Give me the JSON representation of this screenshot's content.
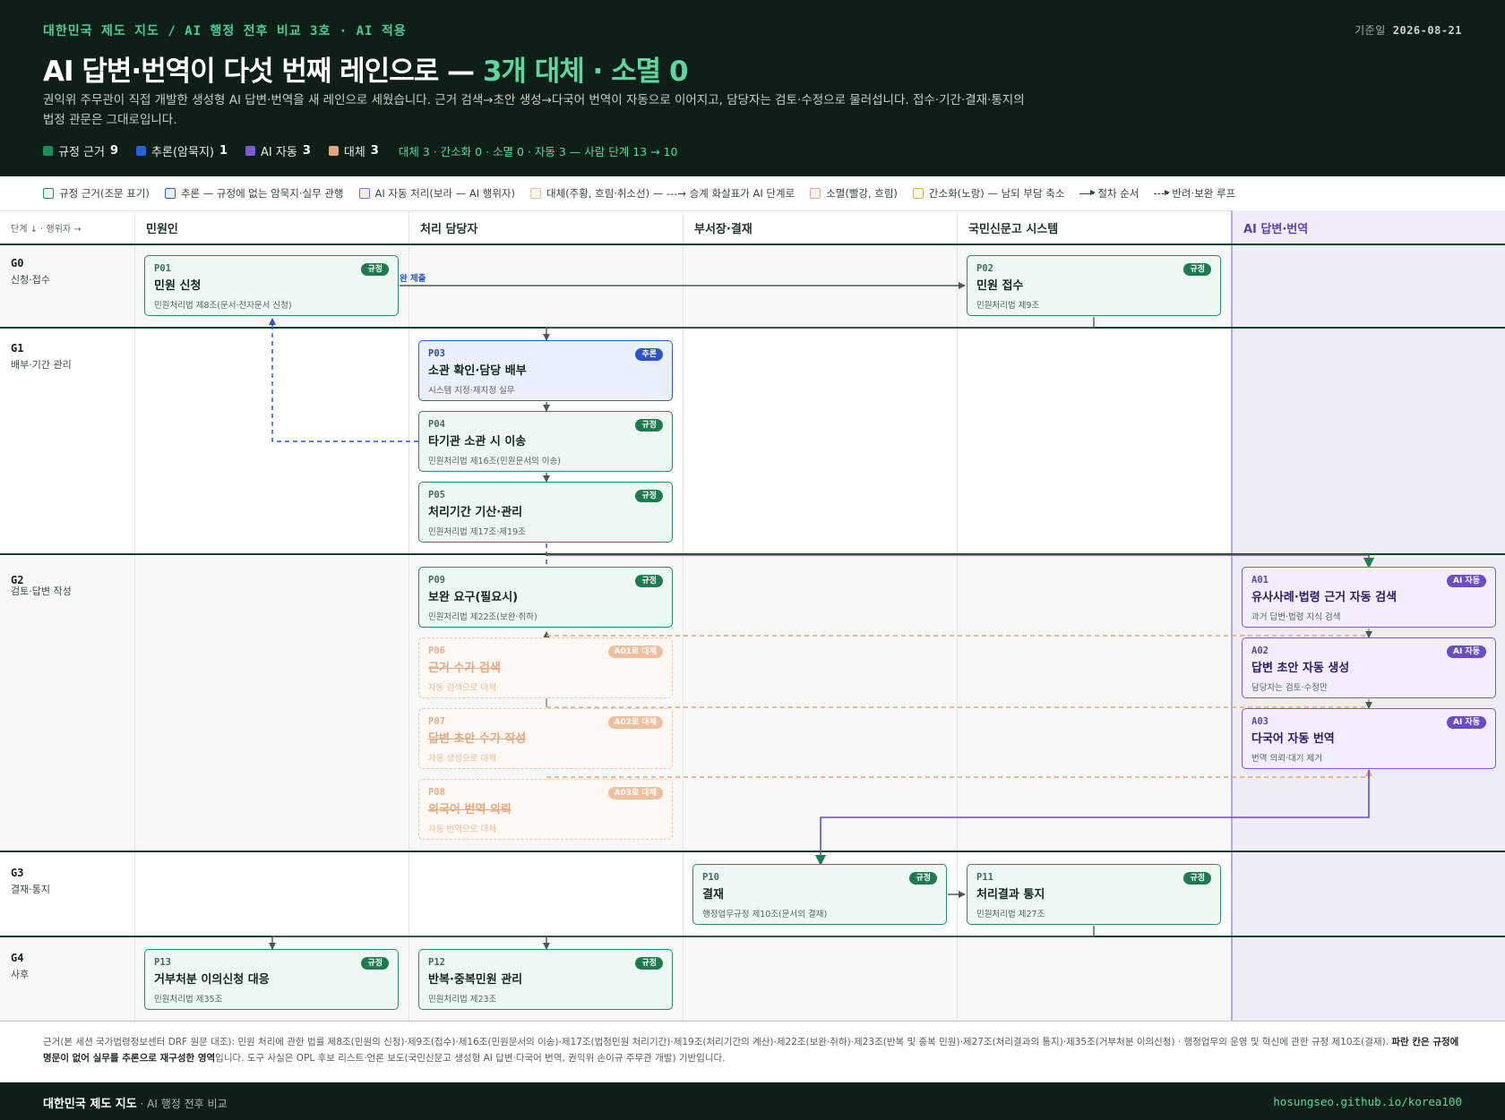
{
  "header": {
    "crumb": "대한민국 제도 지도 / AI 행정 전후 비교 3호 · AI 적용",
    "date_label": "기준일",
    "date": "2026-08-21",
    "title_main": "AI 답변·번역이 다섯 번째 레인으로 — ",
    "title_accent": "3개 대체 · 소멸 0",
    "lede": "권익위 주무관이 직접 개발한 생성형 AI 답변·번역을 새 레인으로 세웠습니다. 근거 검색→초안 생성→다국어 번역이 자동으로 이어지고, 담당자는 검토·수정으로 물러섭니다. 접수·기간·결재·통지의 법정 관문은 그대로입니다.",
    "stats": [
      {
        "label": "규정 근거",
        "value": "9",
        "color": "#1f8a5a"
      },
      {
        "label": "추론(암묵지)",
        "value": "1",
        "color": "#2c5fd6"
      },
      {
        "label": "AI 자동",
        "value": "3",
        "color": "#7a5ccc"
      },
      {
        "label": "대체",
        "value": "3",
        "color": "#e3a67a"
      }
    ],
    "summary": "대체 3 · 간소화 0 · 소멸 0 · 자동 3 — 사람 단계 13 → 10"
  },
  "legend": {
    "items": [
      {
        "label": "규정 근거(조문 표기)",
        "border": "#2e8a60",
        "fill": "#eef8f2"
      },
      {
        "label": "추론 — 규정에 없는 암묵지·실무 관행",
        "border": "#2c5fd6",
        "fill": "#eaf0fd"
      },
      {
        "label": "AI 자동 처리(보라 — AI 행위자)",
        "border": "#8a6cd8",
        "fill": "#f2eefd"
      },
      {
        "label": "대체(주황, 흐림·취소선) — ---→ 승계 화살표가 AI 단계로",
        "border": "#efc0a0",
        "fill": "#fdf6ef"
      },
      {
        "label": "소멸(빨강, 흐림)",
        "border": "#eaa0a0",
        "fill": "#fdf2f2"
      },
      {
        "label": "간소화(노랑) — 남되 부담 축소",
        "border": "#e4b83c",
        "fill": "#fdf8e8"
      }
    ],
    "arrow_solid": "절차 순서",
    "arrow_dashed": "반려·보완 루프"
  },
  "grid": {
    "axis_label": "단계 ↓ · 행위자 →",
    "columns": [
      "민원인",
      "처리 담당자",
      "부서장·결재",
      "국민신문고 시스템",
      "AI 답변·번역"
    ],
    "stages": [
      {
        "id": "G0",
        "name": "신청·접수"
      },
      {
        "id": "G1",
        "name": "배부·기간 관리"
      },
      {
        "id": "G2",
        "name": "검토·답변 작성"
      },
      {
        "id": "G3",
        "name": "결재·통지"
      },
      {
        "id": "G4",
        "name": "사후"
      }
    ]
  },
  "cards": {
    "p01": {
      "id": "P01",
      "title": "민원 신청",
      "sub": "민원처리법 제8조(문서·전자문서 신청)",
      "badge": "규정"
    },
    "p02": {
      "id": "P02",
      "title": "민원 접수",
      "sub": "민원처리법 제9조",
      "badge": "규정"
    },
    "p03": {
      "id": "P03",
      "title": "소관 확인·담당 배부",
      "sub": "시스템 지정·재지정 실무",
      "badge": "추론"
    },
    "p04": {
      "id": "P04",
      "title": "타기관 소관 시 이송",
      "sub": "민원처리법 제16조(민원문서의 이송)",
      "badge": "규정"
    },
    "p05": {
      "id": "P05",
      "title": "처리기간 기산·관리",
      "sub": "민원처리법 제17조·제19조",
      "badge": "규정"
    },
    "p09": {
      "id": "P09",
      "title": "보완 요구(필요시)",
      "sub": "민원처리법 제22조(보완·취하)",
      "badge": "규정"
    },
    "p06": {
      "id": "P06",
      "title": "근거 수가 검색",
      "sub": "자동 검색으로 대체",
      "badge": "A01로 대체"
    },
    "p07": {
      "id": "P07",
      "title": "답변 초안 수가 작성",
      "sub": "자동 생성으로 대체",
      "badge": "A02로 대체"
    },
    "p08": {
      "id": "P08",
      "title": "외국어 번역 의뢰",
      "sub": "자동 번역으로 대체",
      "badge": "A03로 대체"
    },
    "a01": {
      "id": "A01",
      "title": "유사사례·법령 근거 자동 검색",
      "sub": "과거 답변·법령 지식 검색",
      "badge": "AI 자동"
    },
    "a02": {
      "id": "A02",
      "title": "답변 초안 자동 생성",
      "sub": "담당자는 검토·수정만",
      "badge": "AI 자동"
    },
    "a03": {
      "id": "A03",
      "title": "다국어 자동 번역",
      "sub": "번역 의뢰·대기 제거",
      "badge": "AI 자동"
    },
    "p10": {
      "id": "P10",
      "title": "결재",
      "sub": "행정업무규정 제10조(문서의 결재)",
      "badge": "규정"
    },
    "p11": {
      "id": "P11",
      "title": "처리결과 통지",
      "sub": "민원처리법 제27조",
      "badge": "규정"
    },
    "p13": {
      "id": "P13",
      "title": "거부처분 이의신청 대응",
      "sub": "민원처리법 제35조",
      "badge": "규정"
    },
    "p12": {
      "id": "P12",
      "title": "반복·중복민원 관리",
      "sub": "민원처리법 제23조",
      "badge": "규정"
    }
  },
  "edge_label": "완 제출",
  "footnote": {
    "text": "근거(본 세션 국가법령정보센터 DRF 원문 대조): 민원 처리에 관한 법률 제8조(민원의 신청)·제9조(접수)·제16조(민원문서의 이송)·제17조(법정민원 처리기간)·제19조(처리기간의 계산)·제22조(보완·취하)·제23조(반복 및 중복 민원)·제27조(처리결과의 통지)·제35조(거부처분 이의신청) · 행정업무의 운영 및 혁신에 관한 규정 제10조(결재). ",
    "bold": "파란 칸은 규정에 명문이 없어 실무를 추론으로 재구성한 영역",
    "tail": "입니다. 도구 사실은 OPL 후보 리스트·언론 보도(국민신문고 생성형 AI 답변·다국어 번역, 권익위 손이규 주무관 개발) 기반입니다."
  },
  "footer": {
    "brand": "대한민국 제도 지도",
    "sub": " · AI 행정 전후 비교",
    "url": "hosungseo.github.io/korea100"
  },
  "colors": {
    "header_bg": "#0d1f17",
    "accent": "#5ed6a0",
    "rule": "#1f8a5a",
    "inference": "#2c5fd6",
    "ai": "#7a5ccc",
    "replaced": "#e3a67a"
  }
}
